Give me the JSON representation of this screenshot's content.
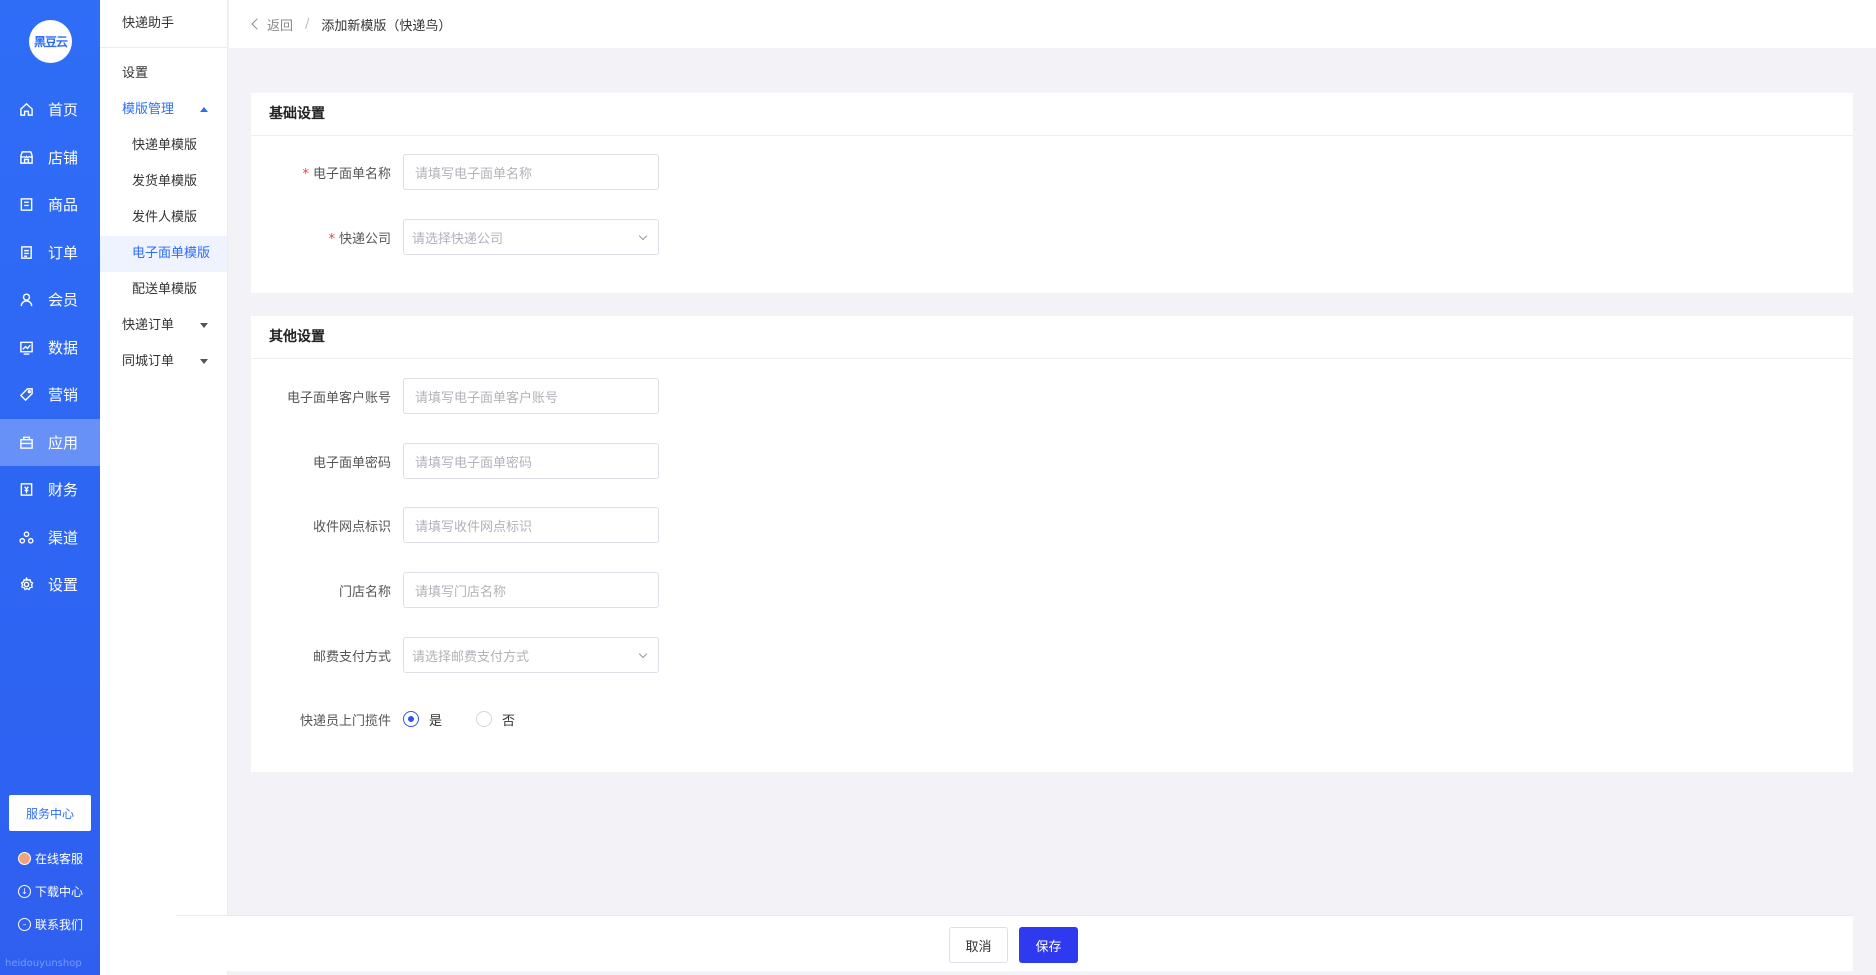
{
  "logo": {
    "text": "黑豆云"
  },
  "nav": {
    "items": [
      {
        "label": "首页"
      },
      {
        "label": "店铺"
      },
      {
        "label": "商品"
      },
      {
        "label": "订单"
      },
      {
        "label": "会员"
      },
      {
        "label": "数据"
      },
      {
        "label": "营销"
      },
      {
        "label": "应用"
      },
      {
        "label": "财务"
      },
      {
        "label": "渠道"
      },
      {
        "label": "设置"
      }
    ],
    "service_center": "服务中心",
    "online_service": "在线客服",
    "download_center": "下载中心",
    "contact_us": "联系我们",
    "watermark": "heidouyunshop"
  },
  "subnav": {
    "title": "快递助手",
    "items": {
      "settings": "设置",
      "template_manage": "模版管理",
      "express_template": "快递单模版",
      "delivery_template": "发货单模版",
      "sender_template": "发件人模版",
      "eorder_template": "电子面单模版",
      "dispatch_template": "配送单模版",
      "express_order": "快递订单",
      "local_order": "同城订单"
    }
  },
  "header": {
    "back": "返回",
    "sep": "/",
    "title": "添加新模版（快递鸟）"
  },
  "basic": {
    "title": "基础设置",
    "name_label": "电子面单名称",
    "name_placeholder": "请填写电子面单名称",
    "company_label": "快递公司",
    "company_placeholder": "请选择快递公司"
  },
  "other": {
    "title": "其他设置",
    "account_label": "电子面单客户账号",
    "account_placeholder": "请填写电子面单客户账号",
    "password_label": "电子面单密码",
    "password_placeholder": "请填写电子面单密码",
    "site_label": "收件网点标识",
    "site_placeholder": "请填写收件网点标识",
    "store_label": "门店名称",
    "store_placeholder": "请填写门店名称",
    "pay_label": "邮费支付方式",
    "pay_placeholder": "请选择邮费支付方式",
    "pickup_label": "快递员上门揽件",
    "pickup_yes": "是",
    "pickup_no": "否"
  },
  "footer": {
    "cancel": "取消",
    "save": "保存"
  },
  "colors": {
    "brand": "#2f6df7",
    "primary_button": "#2f39f0",
    "required": "#f03c3c"
  }
}
